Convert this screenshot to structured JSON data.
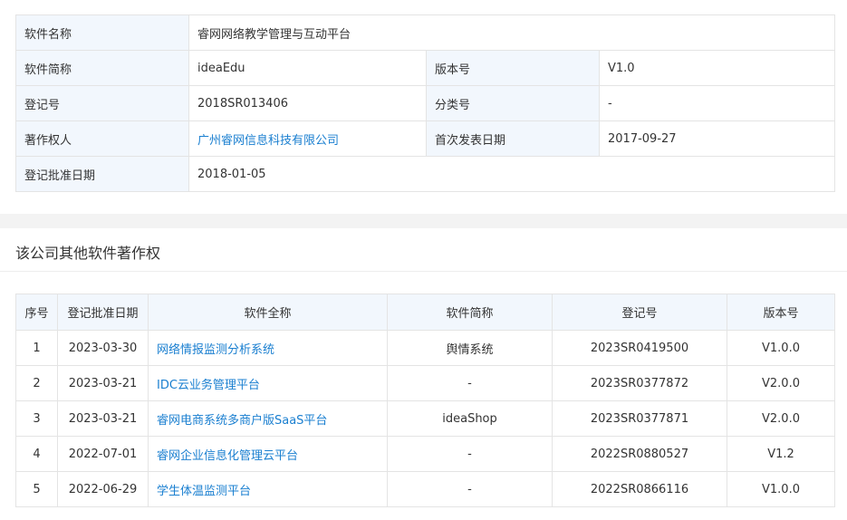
{
  "info": {
    "name_label": "软件名称",
    "name_value": "睿网网络教学管理与互动平台",
    "short_label": "软件简称",
    "short_value": "ideaEdu",
    "version_label": "版本号",
    "version_value": "V1.0",
    "regno_label": "登记号",
    "regno_value": "2018SR013406",
    "category_label": "分类号",
    "category_value": "-",
    "owner_label": "著作权人",
    "owner_value": "广州睿网信息科技有限公司",
    "firstpub_label": "首次发表日期",
    "firstpub_value": "2017-09-27",
    "approval_label": "登记批准日期",
    "approval_value": "2018-01-05"
  },
  "other": {
    "title": "该公司其他软件著作权",
    "headers": [
      "序号",
      "登记批准日期",
      "软件全称",
      "软件简称",
      "登记号",
      "版本号"
    ],
    "rows": [
      [
        "1",
        "2023-03-30",
        "网络情报监测分析系统",
        "舆情系统",
        "2023SR0419500",
        "V1.0.0"
      ],
      [
        "2",
        "2023-03-21",
        "IDC云业务管理平台",
        "-",
        "2023SR0377872",
        "V2.0.0"
      ],
      [
        "3",
        "2023-03-21",
        "睿网电商系统多商户版SaaS平台",
        "ideaShop",
        "2023SR0377871",
        "V2.0.0"
      ],
      [
        "4",
        "2022-07-01",
        "睿网企业信息化管理云平台",
        "-",
        "2022SR0880527",
        "V1.2"
      ],
      [
        "5",
        "2022-06-29",
        "学生体温监测平台",
        "-",
        "2022SR0866116",
        "V1.0.0"
      ]
    ]
  },
  "colors": {
    "link": "#1a7fd0",
    "label_bg": "#f2f7fd",
    "border": "#e4e4e4",
    "page_bg": "#f3f3f3"
  }
}
